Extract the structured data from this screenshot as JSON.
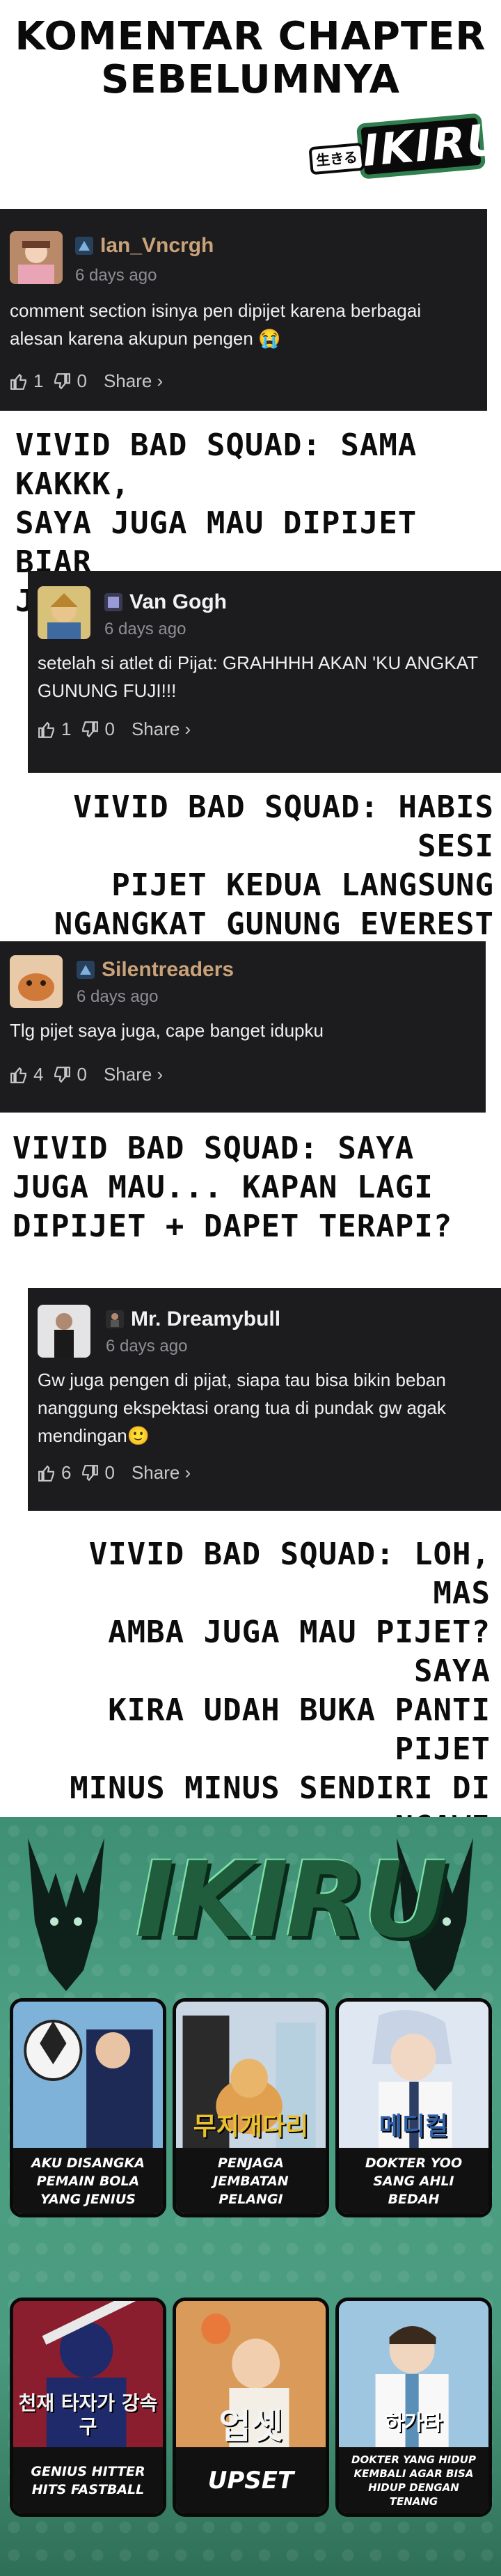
{
  "header": {
    "title": "KOMENTAR CHAPTER\nSEBELUMNYA",
    "logo_text": "IKIRU",
    "logo_jp": "生きる"
  },
  "comments": [
    {
      "username": "Ian_Vncrgh",
      "time": "6 days ago",
      "text": "comment section isinya pen dipijet karena berbagai alesan karena akupun pengen 😭",
      "likes": "1",
      "dislikes": "0",
      "share": "Share ›",
      "name_color": "#c9a27a"
    },
    {
      "username": "Van Gogh",
      "time": "6 days ago",
      "text": "setelah si atlet di Pijat: GRAHHHH AKAN 'KU ANGKAT GUNUNG FUJI!!!",
      "likes": "1",
      "dislikes": "0",
      "share": "Share ›",
      "name_color": "#f2f2f2"
    },
    {
      "username": "Silentreaders",
      "time": "6 days ago",
      "text": "Tlg pijet saya juga, cape banget idupku",
      "likes": "4",
      "dislikes": "0",
      "share": "Share ›",
      "name_color": "#c9a27a"
    },
    {
      "username": "Mr. Dreamybull",
      "time": "6 days ago",
      "text": "Gw juga pengen di pijat, siapa tau bisa bikin beban nanggung ekspektasi orang tua di pundak gw agak mendingan🙂",
      "likes": "6",
      "dislikes": "0",
      "share": "Share ›",
      "name_color": "#f2f2f2"
    }
  ],
  "replies": [
    "VIVID BAD SQUAD: SAMA KAKKK,\nSAYA JUGA MAU DIPIJET BIAR\nJADI TAMPAN DAN KAYA 😔",
    "VIVID BAD SQUAD: HABIS SESI\nPIJET KEDUA LANGSUNG\nNGANGKAT GUNUNG EVEREST",
    "VIVID BAD SQUAD: SAYA\nJUGA MAU... KAPAN LAGI\nDIPIJET + DAPET TERAPI?",
    "VIVID BAD SQUAD: LOH, MAS\nAMBA JUGA MAU PIJET? SAYA\nKIRA UDAH BUKA PANTI PIJET\nMINUS MINUS SENDIRI DI\nNGAWI"
  ],
  "promo": {
    "logo_text": "IKIRU",
    "titles": [
      {
        "label": "AKU DISANGKA PEMAIN BOLA YANG JENIUS",
        "overlay": ""
      },
      {
        "label": "PENJAGA JEMBATAN PELANGI",
        "overlay": "무지개다리"
      },
      {
        "label": "DOKTER YOO SANG AHLI BEDAH",
        "overlay": "메디컬"
      },
      {
        "label": "GENIUS HITTER HITS FASTBALL",
        "overlay": "천재 타자가 강속구"
      },
      {
        "label": "UPSET",
        "overlay": "업셋"
      },
      {
        "label": "DOKTER YANG HIDUP KEMBALI AGAR BISA HIDUP DENGAN TENANG",
        "overlay": "하가타"
      }
    ]
  },
  "colors": {
    "card_bg": "#1c1c1e",
    "gold_name": "#c9a27a",
    "promo_green": "#4a9b7f"
  }
}
